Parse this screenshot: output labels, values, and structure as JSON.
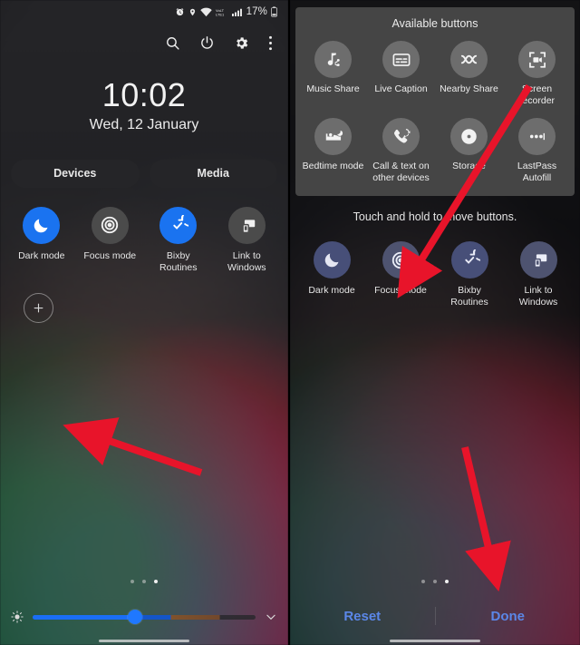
{
  "left_panel": {
    "status_bar": {
      "icons": [
        "alarm-icon",
        "location-icon",
        "wifi-icon",
        "volte-icon",
        "signal-icon"
      ],
      "battery_text": "17%"
    },
    "header_icons": [
      "search-icon",
      "power-icon",
      "settings-gear-icon",
      "more-options-icon"
    ],
    "clock": {
      "time": "10:02",
      "date": "Wed, 12 January"
    },
    "pills": [
      {
        "label": "Devices"
      },
      {
        "label": "Media"
      }
    ],
    "toggles": [
      {
        "label": "Dark mode",
        "icon": "moon-icon",
        "state": "on"
      },
      {
        "label": "Focus mode",
        "icon": "target-icon",
        "state": "off"
      },
      {
        "label": "Bixby Routines",
        "icon": "check-circle-icon",
        "state": "on"
      },
      {
        "label": "Link to Windows",
        "icon": "link-windows-icon",
        "state": "off"
      }
    ],
    "add_button": {
      "icon": "plus-icon",
      "label": "+"
    },
    "page_dots": {
      "count": 3,
      "active_index": 2
    },
    "brightness": {
      "left_icon": "brightness-icon",
      "right_icon": "chevron-down-icon",
      "value_percent": 46
    }
  },
  "right_panel": {
    "sheet": {
      "title": "Available buttons",
      "buttons": [
        {
          "label": "Music Share",
          "icon": "music-share-icon"
        },
        {
          "label": "Live Caption",
          "icon": "live-caption-icon"
        },
        {
          "label": "Nearby Share",
          "icon": "nearby-share-icon"
        },
        {
          "label": "Screen recorder",
          "icon": "screen-recorder-icon"
        },
        {
          "label": "Bedtime mode",
          "icon": "bedtime-icon"
        },
        {
          "label": "Call & text on other devices",
          "icon": "call-text-icon"
        },
        {
          "label": "Storage",
          "icon": "storage-icon"
        },
        {
          "label": "LastPass Autofill",
          "icon": "lastpass-icon"
        }
      ]
    },
    "hint": "Touch and hold to move buttons.",
    "toggles": [
      {
        "label": "Dark mode",
        "icon": "moon-icon"
      },
      {
        "label": "Focus mode",
        "icon": "target-icon"
      },
      {
        "label": "Bixby Routines",
        "icon": "check-circle-icon"
      },
      {
        "label": "Link to Windows",
        "icon": "link-windows-icon"
      }
    ],
    "page_dots": {
      "count": 3,
      "active_index": 2
    },
    "actions": [
      {
        "label": "Reset"
      },
      {
        "label": "Done"
      }
    ]
  },
  "annotations": {
    "arrow_color": "#e8142a",
    "arrows": [
      {
        "name": "arrow-to-add-button",
        "panel": "left"
      },
      {
        "name": "arrow-to-focus-mode",
        "panel": "right"
      },
      {
        "name": "arrow-to-done-button",
        "panel": "right"
      }
    ]
  }
}
